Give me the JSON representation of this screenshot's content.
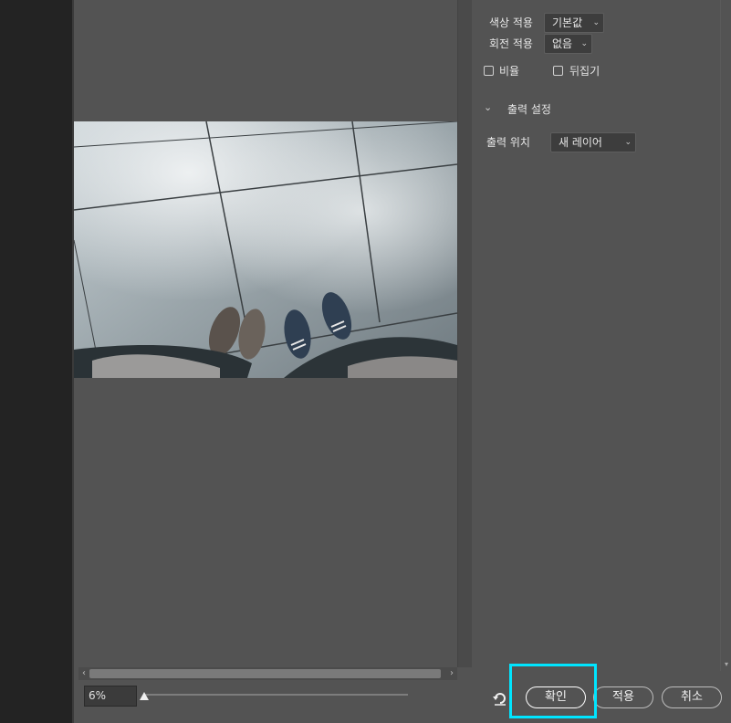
{
  "zoom": {
    "value": "6%",
    "level_percent": 6
  },
  "settings": {
    "color_apply": {
      "label": "색상 적용",
      "value": "기본값"
    },
    "rotation_apply": {
      "label": "회전 적용",
      "value": "없음"
    },
    "ratio_label": "비율",
    "flip_label": "뒤집기"
  },
  "output_section": {
    "title": "출력 설정",
    "location_label": "출력 위치",
    "location_value": "새 레이어"
  },
  "buttons": {
    "ok": "확인",
    "apply": "적용",
    "cancel": "취소"
  },
  "icons": {
    "reset": "reset-icon",
    "dropdown": "chevron-down-icon",
    "section_toggle": "chevron-down-icon"
  },
  "colors": {
    "highlight": "#00e5ff",
    "panel_bg": "#535353"
  }
}
